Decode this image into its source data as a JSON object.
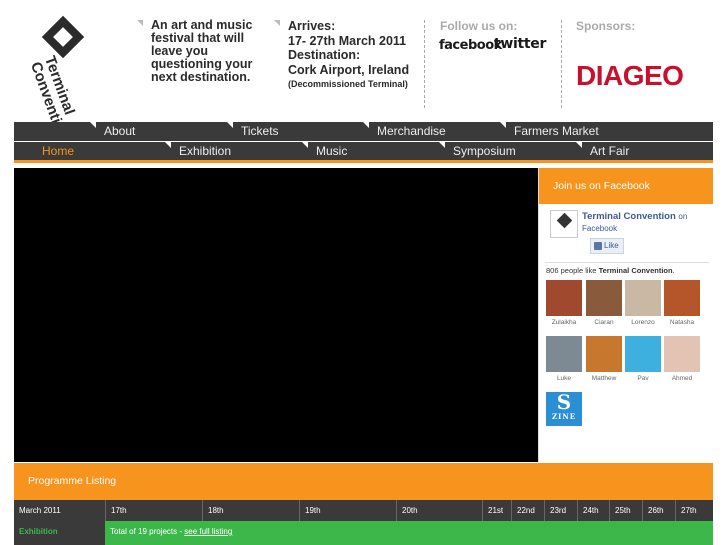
{
  "header": {
    "logo_line1": "Terminal",
    "logo_line2": "Convention",
    "tagline": "An art and music festival that will leave you questioning your next destination.",
    "arrives_label": "Arrives:",
    "arrives_dates": "17- 27th March 2011",
    "destination_label": "Destination:",
    "destination": "Cork Airport, Ireland",
    "destination_note": "(Decommissioned Terminal)",
    "follow_title": "Follow us on:",
    "facebook": "facebook",
    "twitter": "twitter",
    "sponsors_title": "Sponsors:",
    "sponsor": "DIAGEO",
    "sponsor_color": "#c8102e"
  },
  "nav": {
    "row1": [
      "About",
      "Tickets",
      "Merchandise",
      "Farmers Market"
    ],
    "row2": [
      "Home",
      "Exhibition",
      "Music",
      "Symposium",
      "Art Fair"
    ],
    "active": "Home",
    "accent": "#f7941d"
  },
  "facebook_box": {
    "title": "Join us on Facebook",
    "page_name": "Terminal Convention",
    "on": "on",
    "network": "Facebook",
    "like_label": "Like",
    "likes_count_prefix": "806 people like",
    "likes_count_page": "Terminal Convention",
    "likes_count_suffix": ".",
    "fans": [
      {
        "name": "Zulaikha",
        "color": "#a0492e"
      },
      {
        "name": "Ciaran",
        "color": "#8a5a3c"
      },
      {
        "name": "Lorenzo",
        "color": "#c9b8a4"
      },
      {
        "name": "Natasha",
        "color": "#b5562a"
      },
      {
        "name": "Luke",
        "color": "#7d8a93"
      },
      {
        "name": "Matthew",
        "color": "#c8782e"
      },
      {
        "name": "Pav",
        "color": "#3db0e0"
      },
      {
        "name": "Ahmed",
        "color": "#e3c3b4"
      }
    ],
    "badge_letter": "S",
    "badge_word": "ZINE"
  },
  "programme": {
    "title": "Programme Listing",
    "month": "March 2011",
    "days": [
      "17th",
      "18th",
      "19th",
      "20th",
      "21st",
      "22nd",
      "23rd",
      "24th",
      "25th",
      "26th",
      "27th"
    ],
    "rows": [
      {
        "label": "Exhibition",
        "total": "Total of 19 projects - ",
        "link": "see full listing"
      }
    ]
  }
}
